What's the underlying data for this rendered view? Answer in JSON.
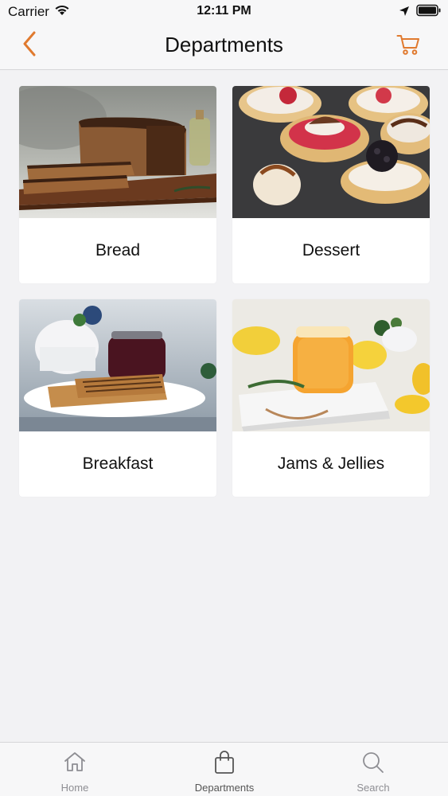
{
  "status_bar": {
    "carrier": "Carrier",
    "time": "12:11 PM",
    "icons": [
      "wifi-icon",
      "location-arrow-icon",
      "battery-icon"
    ]
  },
  "nav": {
    "title": "Departments",
    "back_icon": "chevron-left-icon",
    "cart_icon": "cart-icon",
    "accent_color": "#e07a2f"
  },
  "departments": [
    {
      "label": "Bread",
      "image": "bread-photo"
    },
    {
      "label": "Dessert",
      "image": "dessert-tarts-photo"
    },
    {
      "label": "Breakfast",
      "image": "breakfast-toast-jam-photo"
    },
    {
      "label": "Jams & Jellies",
      "image": "jam-jar-lemons-photo"
    }
  ],
  "tab_bar": {
    "tabs": [
      {
        "label": "Home",
        "icon": "home-icon",
        "active": false
      },
      {
        "label": "Departments",
        "icon": "shopping-bag-icon",
        "active": true
      },
      {
        "label": "Search",
        "icon": "search-icon",
        "active": false
      }
    ]
  }
}
